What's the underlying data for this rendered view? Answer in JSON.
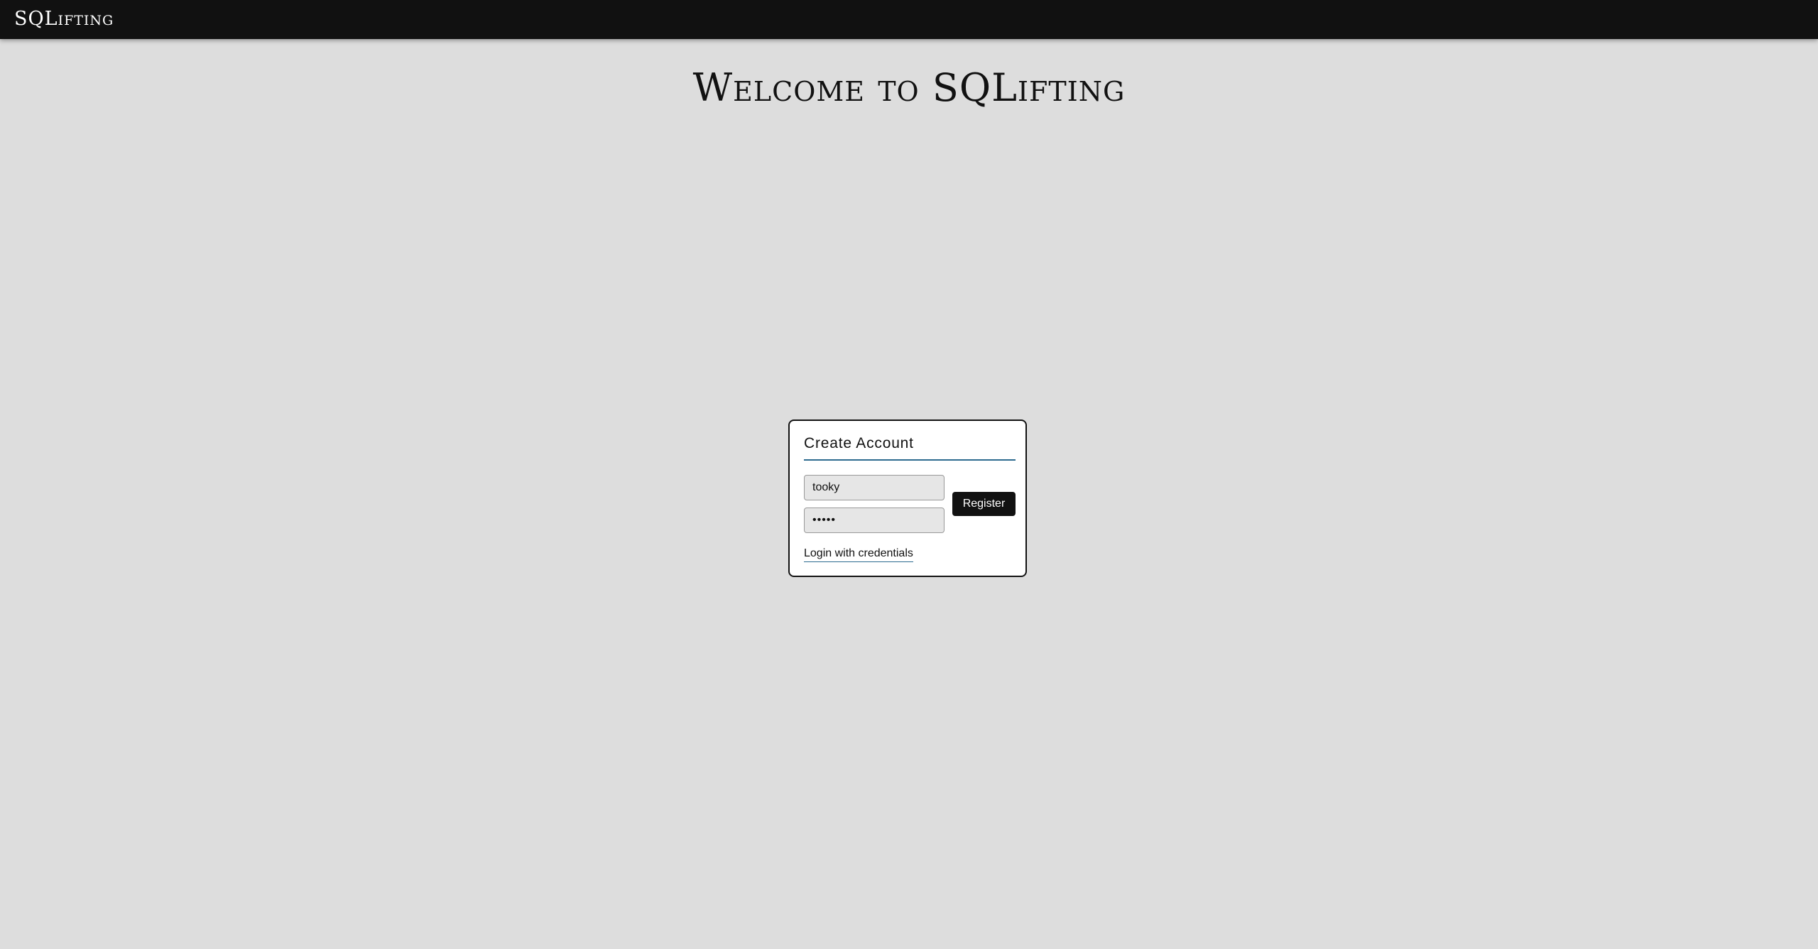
{
  "header": {
    "brand": "SQLifting"
  },
  "main": {
    "title": "Welcome to SQLifting"
  },
  "card": {
    "title": "Create Account",
    "username": {
      "value": "tooky"
    },
    "password": {
      "value": "•••••"
    },
    "register_label": "Register",
    "login_link": "Login with credentials"
  },
  "colors": {
    "topbar": "#111111",
    "background": "#dddddd",
    "accent_underline": "#2c6a8f",
    "button": "#111111"
  }
}
